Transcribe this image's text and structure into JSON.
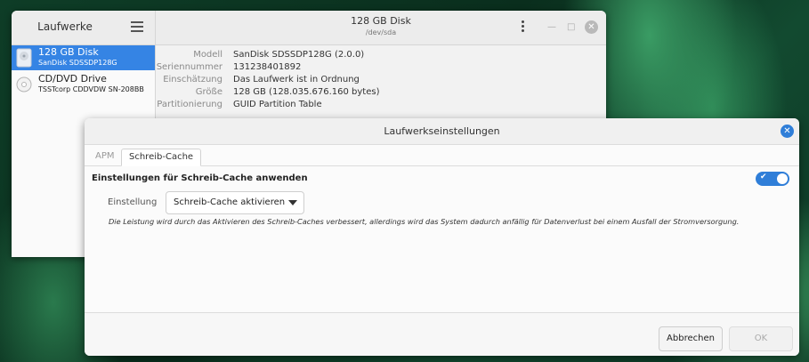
{
  "disks_window": {
    "sidebar_title": "Laufwerke",
    "drives": [
      {
        "name": "128 GB Disk",
        "model": "SanDisk SDSSDP128G",
        "selected": true
      },
      {
        "name": "CD/DVD Drive",
        "model": "TSSTcorp CDDVDW SN-208BB",
        "selected": false
      }
    ],
    "title": "128 GB Disk",
    "subtitle": "/dev/sda",
    "info": [
      {
        "key": "Modell",
        "value": "SanDisk SDSSDP128G (2.0.0)"
      },
      {
        "key": "Seriennummer",
        "value": "131238401892"
      },
      {
        "key": "Einschätzung",
        "value": "Das Laufwerk ist in Ordnung"
      },
      {
        "key": "Größe",
        "value": "128 GB (128.035.676.160 bytes)"
      },
      {
        "key": "Partitionierung",
        "value": "GUID Partition Table"
      }
    ]
  },
  "dialog": {
    "title": "Laufwerkseinstellungen",
    "tabs": [
      {
        "label": "APM",
        "active": false
      },
      {
        "label": "Schreib-Cache",
        "active": true
      }
    ],
    "setting_label": "Einstellungen für Schreib-Cache anwenden",
    "toggle_on": true,
    "einstellung_label": "Einstellung",
    "dropdown_value": "Schreib-Cache aktivieren",
    "description": "Die Leistung wird durch das Aktivieren des Schreib-Caches verbessert, allerdings wird das System dadurch anfällig für Datenverlust bei einem Ausfall der Stromversorgung.",
    "cancel_label": "Abbrechen",
    "ok_label": "OK"
  },
  "colors": {
    "accent": "#3584e4",
    "toggle": "#2f7ed8"
  },
  "icons": {
    "sidebar_menu": "hamburger-menu-icon",
    "more": "kebab-menu-icon",
    "close": "close-icon",
    "disk": "disk-icon",
    "optical": "optical-disc-icon",
    "check": "check-icon",
    "dropdown": "chevron-down-icon"
  }
}
